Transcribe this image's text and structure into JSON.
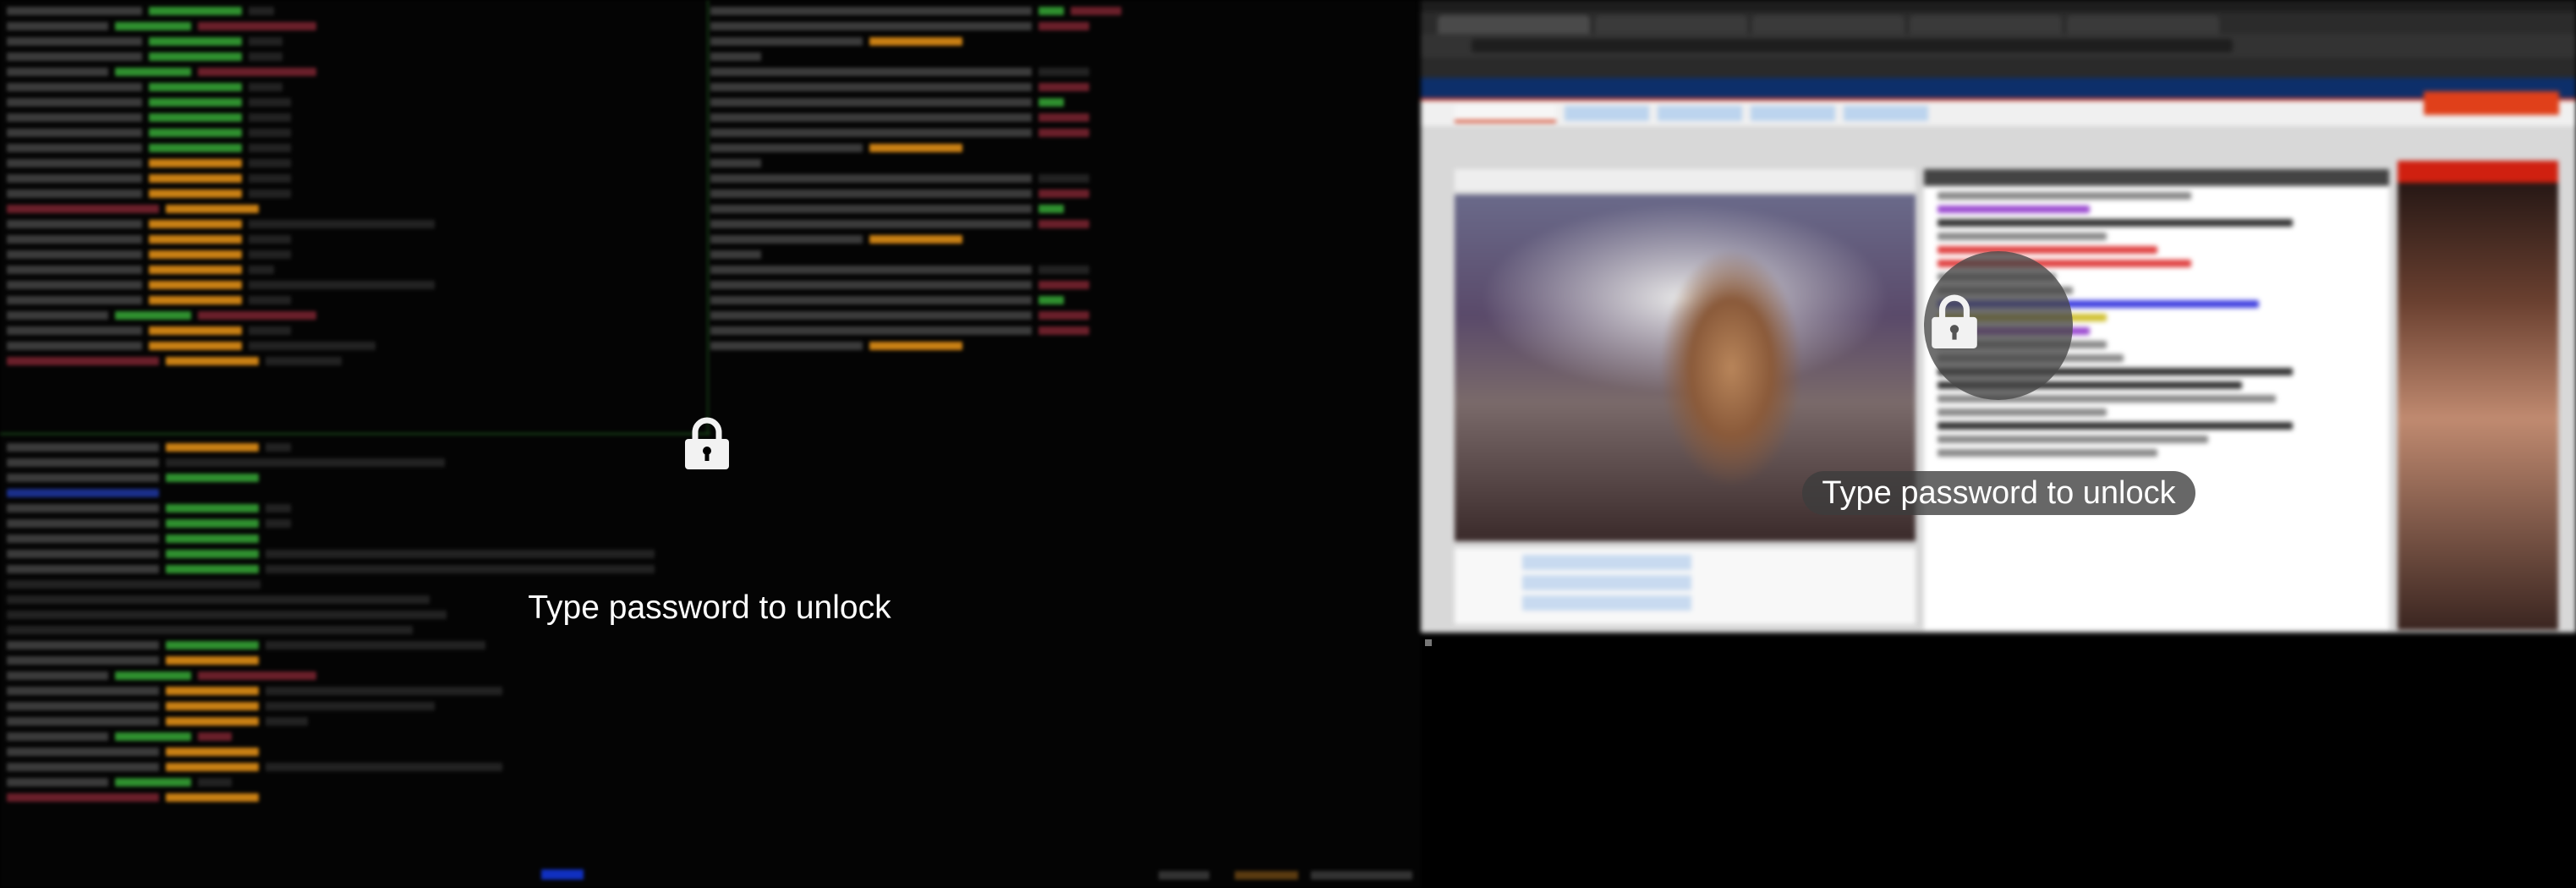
{
  "lock_screen": {
    "primary_prompt": "Type password to unlock",
    "secondary_prompt": "Type password to unlock",
    "lock_icon": "lock-icon",
    "colors": {
      "background": "#000000",
      "text": "#ffffff",
      "overlay": "#464646"
    }
  }
}
